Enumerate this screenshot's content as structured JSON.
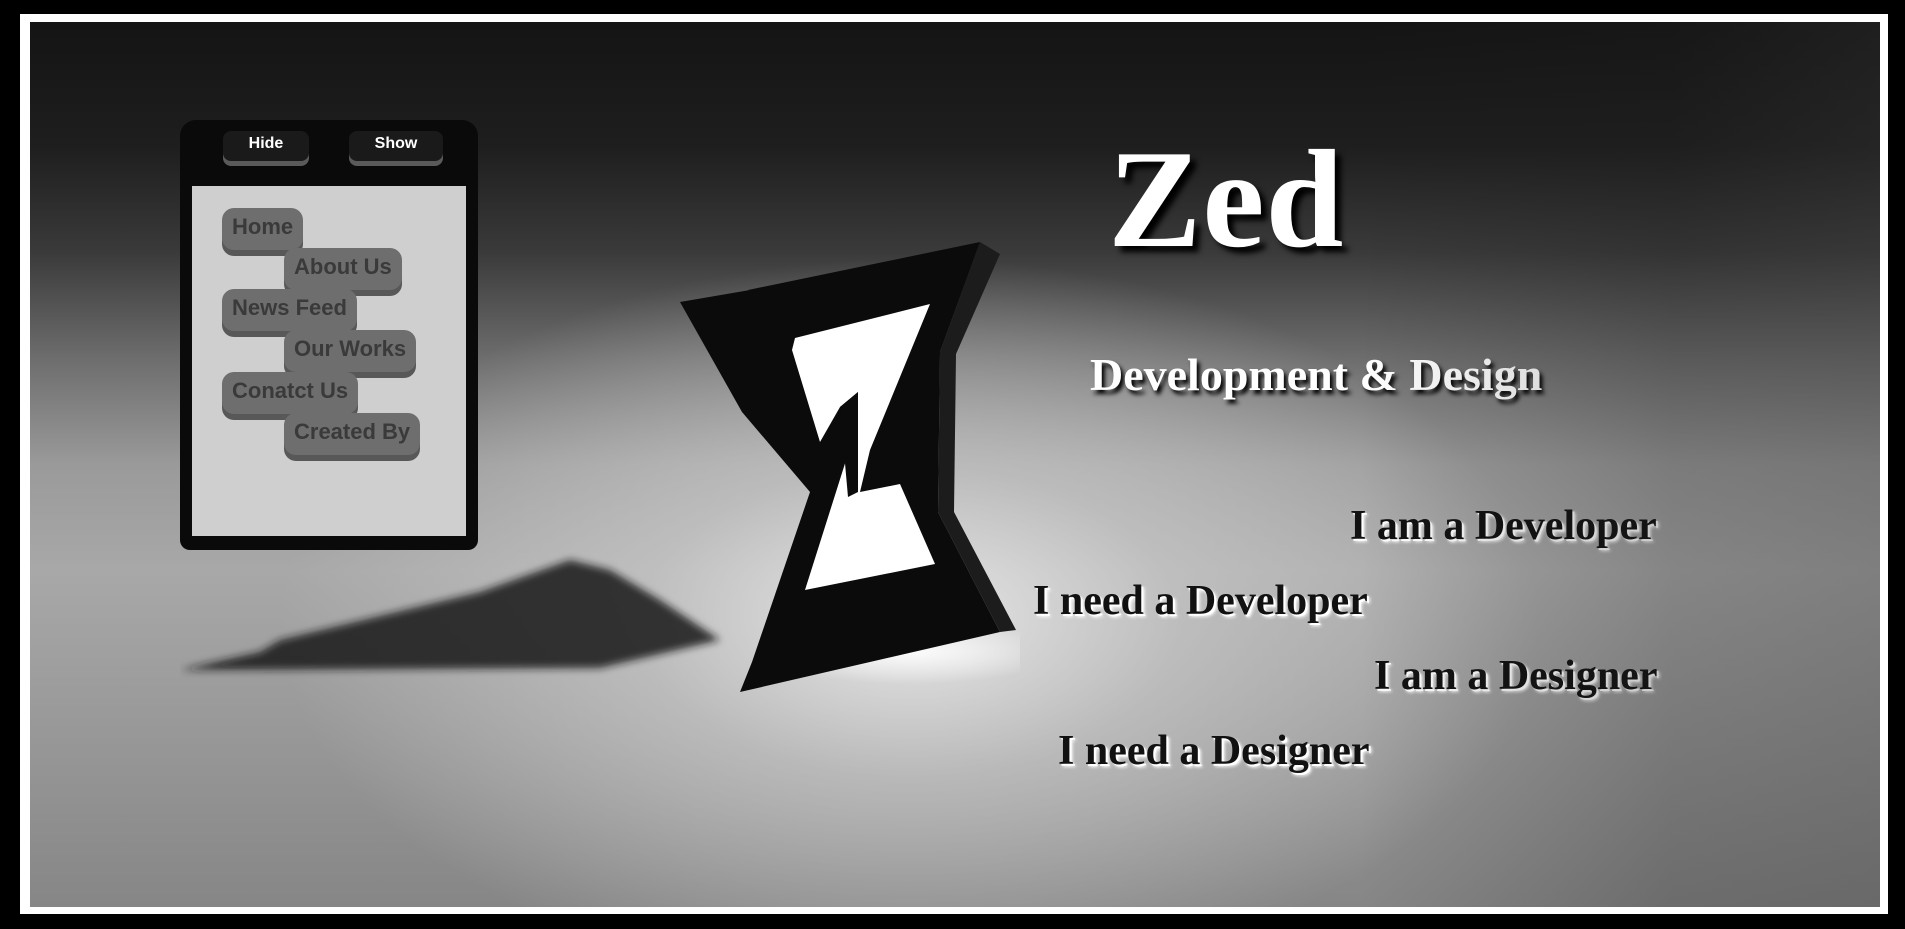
{
  "brand": {
    "title": "Zed",
    "subtitle": "Development & Design"
  },
  "panel": {
    "hide_label": "Hide",
    "show_label": "Show",
    "menu": [
      {
        "label": "Home"
      },
      {
        "label": "About Us"
      },
      {
        "label": "News Feed"
      },
      {
        "label": "Our Works"
      },
      {
        "label": "Conatct Us"
      },
      {
        "label": "Created By"
      }
    ]
  },
  "roles": [
    {
      "label": "I am a Developer"
    },
    {
      "label": "I need a Developer"
    },
    {
      "label": "I am a Designer"
    },
    {
      "label": "I need a Designer"
    }
  ],
  "colors": {
    "frame": "#000000",
    "border": "#ffffff",
    "menu_bg": "#cfcfcf",
    "menu_item": "#6e6e6e",
    "title_text": "#ffffff"
  },
  "icons": {
    "logo": "z-hourglass-logo"
  }
}
